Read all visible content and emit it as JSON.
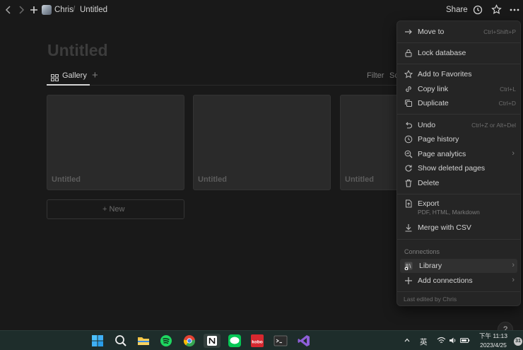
{
  "breadcrumb": {
    "workspace": "Chris",
    "separator": "/",
    "page": "Untitled"
  },
  "topbar": {
    "share_label": "Share"
  },
  "page": {
    "title": "Untitled",
    "tabs": [
      {
        "label": "Gallery"
      }
    ],
    "filter_label": "Filter",
    "sort_label": "Sc",
    "cards": [
      {
        "title": "Untitled"
      },
      {
        "title": "Untitled"
      },
      {
        "title": "Untitled"
      }
    ],
    "new_label": "New"
  },
  "menu": {
    "items": [
      {
        "label": "Move to",
        "shortcut": "Ctrl+Shift+P",
        "icon": "arrow-right-icon"
      },
      {
        "label": "Lock database",
        "icon": "lock-icon"
      },
      {
        "label": "Add to Favorites",
        "icon": "star-icon"
      },
      {
        "label": "Copy link",
        "shortcut": "Ctrl+L",
        "icon": "link-icon"
      },
      {
        "label": "Duplicate",
        "shortcut": "Ctrl+D",
        "icon": "duplicate-icon"
      },
      {
        "label": "Undo",
        "shortcut": "Ctrl+Z or Alt+Del",
        "icon": "undo-icon"
      },
      {
        "label": "Page history",
        "icon": "clock-icon"
      },
      {
        "label": "Page analytics",
        "icon": "analytics-icon"
      },
      {
        "label": "Show deleted pages",
        "icon": "restore-icon"
      },
      {
        "label": "Delete",
        "icon": "trash-icon"
      },
      {
        "label": "Export",
        "sublabel": "PDF, HTML, Markdown",
        "icon": "export-icon"
      },
      {
        "label": "Merge with CSV",
        "icon": "download-icon"
      },
      {
        "label": "Library",
        "icon": "library-icon"
      },
      {
        "label": "Add connections",
        "icon": "plus-icon"
      }
    ],
    "connections_label": "Connections",
    "footer_note": "Last edited by Chris"
  },
  "help_label": "?",
  "taskbar": {
    "tray_language": "英",
    "clock_time": "下午 11:13",
    "clock_date": "2023/4/25",
    "notification_count": "31",
    "kobo_label": "kobo"
  }
}
